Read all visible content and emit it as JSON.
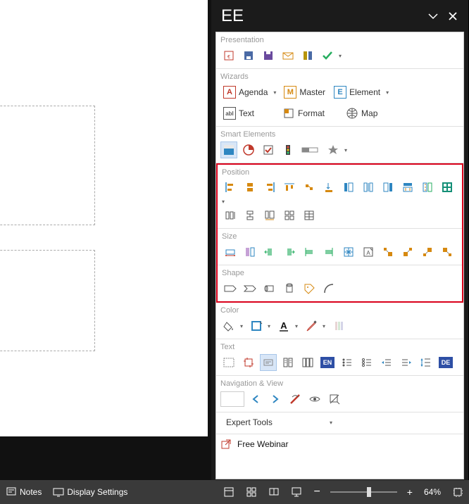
{
  "panel": {
    "title": "EE",
    "sections": {
      "presentation": "Presentation",
      "wizards": "Wizards",
      "smart_elements": "Smart Elements",
      "position": "Position",
      "size": "Size",
      "shape": "Shape",
      "color": "Color",
      "text": "Text",
      "nav_view": "Navigation & View"
    },
    "wizard_items": {
      "agenda_letter": "A",
      "agenda_label": "Agenda",
      "master_letter": "M",
      "master_label": "Master",
      "element_letter": "E",
      "element_label": "Element",
      "text_abc": "abl",
      "text_label": "Text",
      "format_label": "Format",
      "map_label": "Map"
    },
    "text_badges": {
      "en": "EN",
      "de": "DE"
    },
    "expert_tools": "Expert Tools",
    "webinar": "Free Webinar"
  },
  "status": {
    "notes": "Notes",
    "display": "Display Settings",
    "zoom": "64%"
  }
}
